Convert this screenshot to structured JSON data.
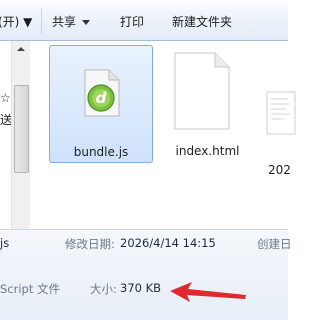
{
  "toolbar": {
    "partial_label": "(开)  ▼",
    "share_label": "共享",
    "print_label": "打印",
    "new_folder_label": "新建文件夹"
  },
  "nav": {
    "items": [
      "☆",
      "送"
    ]
  },
  "files": [
    {
      "name": "bundle.js",
      "selected": true,
      "icon": "dreamweaver-js-file-icon"
    },
    {
      "name": "index.html",
      "selected": false,
      "icon": "blank-document-icon"
    },
    {
      "name": "202",
      "selected": false,
      "icon": "partial-document-icon"
    }
  ],
  "details": {
    "name_suffix": "js",
    "modified_key": "修改日期:",
    "modified_value": "2026/4/14 14:15",
    "created_key": "创建日",
    "type_value": "Script 文件",
    "size_key": "大小:",
    "size_value": "370 KB"
  },
  "colors": {
    "accent_arrow": "#e0282f",
    "selection_border": "#84acdd"
  }
}
